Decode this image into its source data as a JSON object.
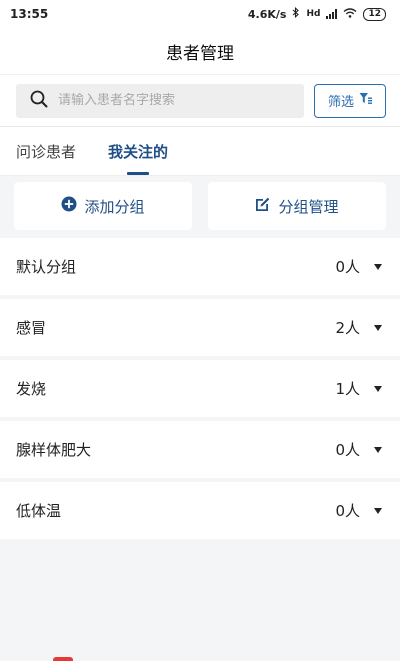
{
  "status_bar": {
    "time": "13:55",
    "network_speed": "4.6K/s",
    "network_type": "Hd",
    "battery": "12"
  },
  "header": {
    "title": "患者管理"
  },
  "search": {
    "placeholder": "请输入患者名字搜索",
    "filter_label": "筛选"
  },
  "tabs": [
    {
      "label": "问诊患者",
      "active": false
    },
    {
      "label": "我关注的",
      "active": true
    }
  ],
  "actions": {
    "add_group": "添加分组",
    "manage_group": "分组管理"
  },
  "groups": [
    {
      "name": "默认分组",
      "count": "0人"
    },
    {
      "name": "感冒",
      "count": "2人"
    },
    {
      "name": "发烧",
      "count": "1人"
    },
    {
      "name": "腺样体肥大",
      "count": "0人"
    },
    {
      "name": "低体温",
      "count": "0人"
    }
  ],
  "colors": {
    "accent": "#1f4f86",
    "filter_border": "#2a6fb0"
  },
  "icons": [
    "search-icon",
    "filter-icon",
    "plus-circle-icon",
    "edit-icon",
    "caret-down-icon",
    "bluetooth-icon",
    "wifi-icon",
    "signal-icon",
    "battery-icon"
  ]
}
